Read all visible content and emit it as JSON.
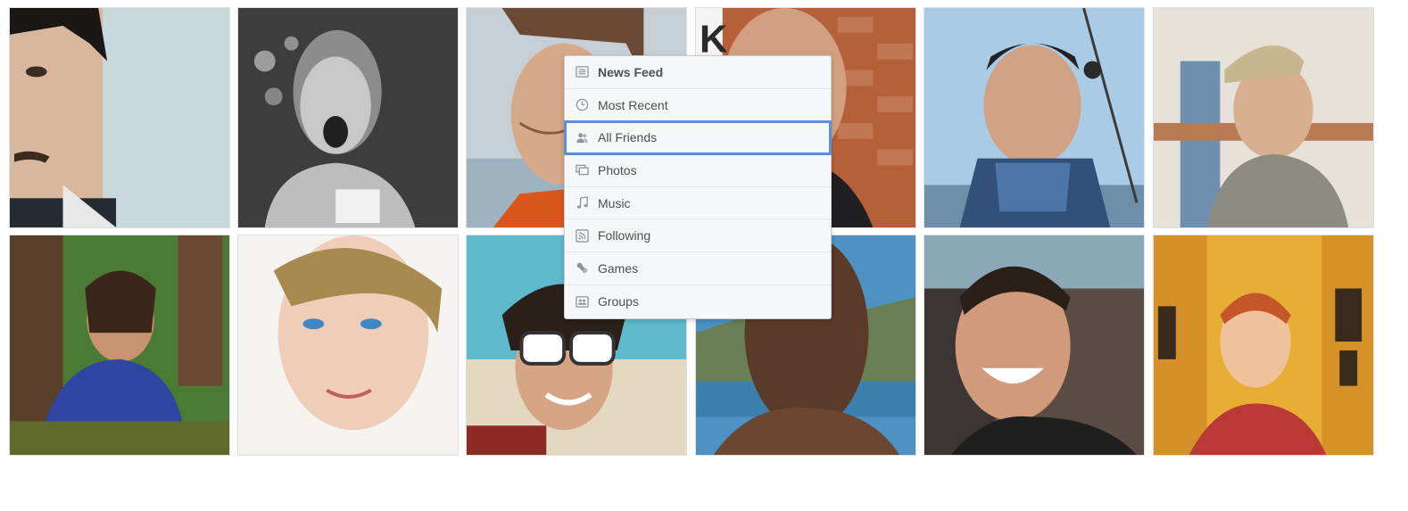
{
  "photo_grid": {
    "photos": [
      {
        "name": "photo-man-mustache",
        "bg": "#c8d8db"
      },
      {
        "name": "photo-woman-laughing-bw",
        "bg": "#5a5a5a"
      },
      {
        "name": "photo-man-smiling-outdoors",
        "bg": "#b4c2cc"
      },
      {
        "name": "photo-man-brick-wall",
        "bg": "#b8673f"
      },
      {
        "name": "photo-man-sailboat",
        "bg": "#9fc3dd"
      },
      {
        "name": "photo-man-cap",
        "bg": "#d9d3c8"
      },
      {
        "name": "photo-girl-forest",
        "bg": "#3f6b2e"
      },
      {
        "name": "photo-woman-blue-eyes",
        "bg": "#f2efe9"
      },
      {
        "name": "photo-woman-sunglasses-beach",
        "bg": "#6cb9c9"
      },
      {
        "name": "photo-man-lake",
        "bg": "#4c7fa6"
      },
      {
        "name": "photo-man-grinning",
        "bg": "#5f4f46"
      },
      {
        "name": "photo-woman-red-hair-hallway",
        "bg": "#e8a832"
      }
    ]
  },
  "menu": {
    "items": [
      {
        "label": "News Feed",
        "icon": "news-feed-icon",
        "bold": true,
        "selected": false
      },
      {
        "label": "Most Recent",
        "icon": "clock-icon",
        "bold": false,
        "selected": false
      },
      {
        "label": "All Friends",
        "icon": "friends-icon",
        "bold": false,
        "selected": true
      },
      {
        "label": "Photos",
        "icon": "photos-icon",
        "bold": false,
        "selected": false
      },
      {
        "label": "Music",
        "icon": "music-note-icon",
        "bold": false,
        "selected": false
      },
      {
        "label": "Following",
        "icon": "rss-icon",
        "bold": false,
        "selected": false
      },
      {
        "label": "Games",
        "icon": "game-controller-icon",
        "bold": false,
        "selected": false
      },
      {
        "label": "Groups",
        "icon": "groups-icon",
        "bold": false,
        "selected": false
      }
    ],
    "selection_color": "#5b8fdc",
    "icon_color": "#90949c"
  }
}
